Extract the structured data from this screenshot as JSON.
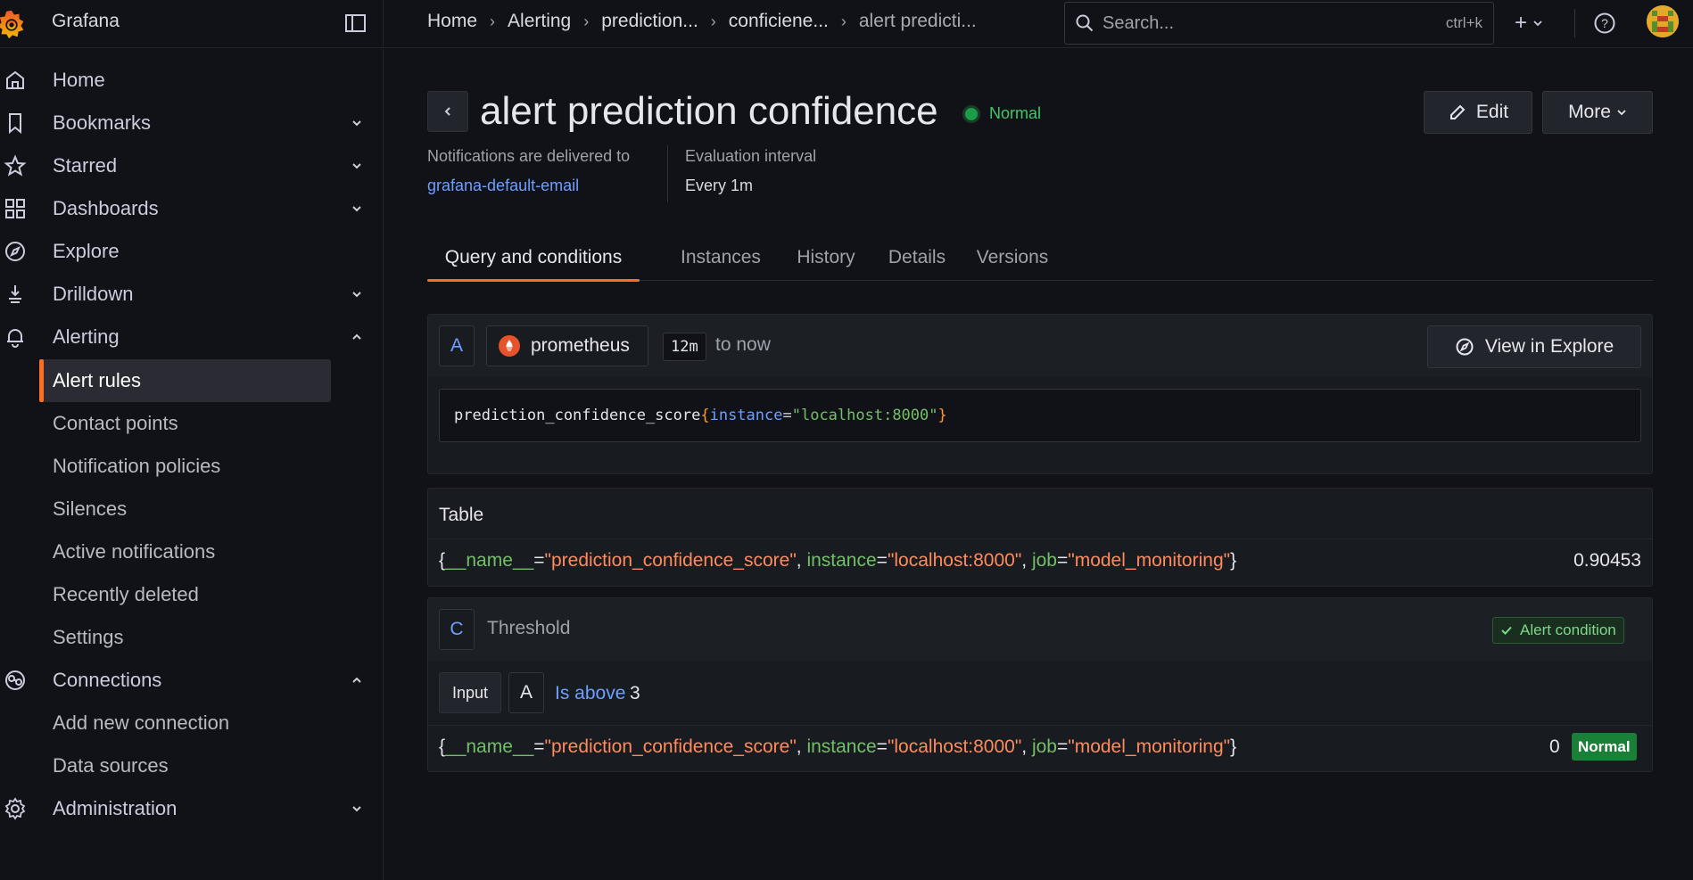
{
  "app": {
    "name": "Grafana"
  },
  "breadcrumb": [
    "Home",
    "Alerting",
    "prediction...",
    "conficiene...",
    "alert predicti..."
  ],
  "search": {
    "placeholder": "Search...",
    "shortcut": "ctrl+k"
  },
  "sidebar": {
    "items": [
      {
        "label": "Home",
        "icon": "home-icon"
      },
      {
        "label": "Bookmarks",
        "icon": "bookmark-icon"
      },
      {
        "label": "Starred",
        "icon": "star-icon"
      },
      {
        "label": "Dashboards",
        "icon": "apps-icon"
      },
      {
        "label": "Explore",
        "icon": "compass-icon"
      },
      {
        "label": "Drilldown",
        "icon": "drilldown-icon"
      },
      {
        "label": "Alerting",
        "icon": "bell-icon"
      },
      {
        "label": "Connections",
        "icon": "connections-icon"
      },
      {
        "label": "Administration",
        "icon": "gear-icon"
      }
    ],
    "alerting_sub": [
      "Alert rules",
      "Contact points",
      "Notification policies",
      "Silences",
      "Active notifications",
      "Recently deleted",
      "Settings"
    ],
    "connections_sub": [
      "Add new connection",
      "Data sources"
    ]
  },
  "rule": {
    "title": "alert prediction confidence",
    "state": "Normal",
    "edit_label": "Edit",
    "more_label": "More",
    "notif_label": "Notifications are delivered to",
    "notif_target": "grafana-default-email",
    "eval_label": "Evaluation interval",
    "eval_value": "Every 1m"
  },
  "tabs": [
    "Query and conditions",
    "Instances",
    "History",
    "Details",
    "Versions"
  ],
  "query": {
    "ref": "A",
    "datasource": "prometheus",
    "time_range": "12m",
    "time_suffix": "to now",
    "explore_label": "View in Explore",
    "metric": "prediction_confidence_score",
    "label_key": "instance",
    "label_value": "\"localhost:8000\""
  },
  "table": {
    "title": "Table",
    "labels": {
      "name_key": "__name__",
      "name_val": "\"prediction_confidence_score\"",
      "instance_key": "instance",
      "instance_val": "\"localhost:8000\"",
      "job_key": "job",
      "job_val": "\"model_monitoring\""
    },
    "value": "0.90453"
  },
  "threshold": {
    "ref": "C",
    "name": "Threshold",
    "alert_condition": "Alert condition",
    "input_label": "Input",
    "input_ref": "A",
    "operator": "Is above",
    "value": "3",
    "result_value": "0",
    "result_state": "Normal"
  },
  "colors": {
    "accent": "#ff6f1f",
    "ok": "#1a7f37",
    "link": "#6e9fff"
  }
}
